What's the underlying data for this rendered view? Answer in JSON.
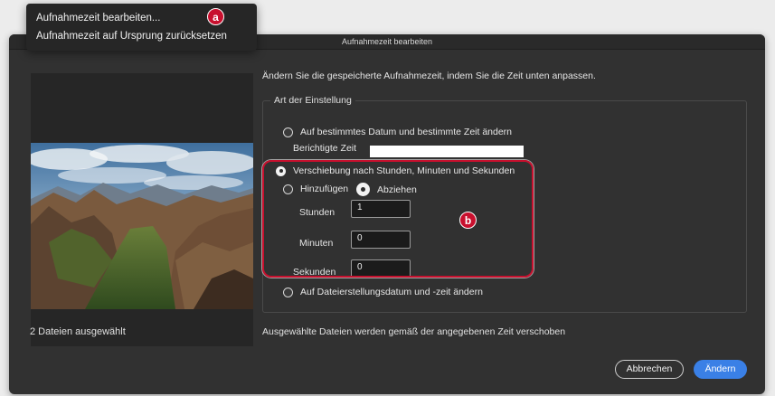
{
  "context_menu": {
    "items": [
      {
        "label": "Aufnahmezeit bearbeiten..."
      },
      {
        "label": "Aufnahmezeit auf Ursprung zurücksetzen"
      }
    ]
  },
  "annotations": {
    "a": "a",
    "b": "b",
    "highlight_color": "#c8102e"
  },
  "dialog": {
    "title": "Aufnahmezeit bearbeiten",
    "instruction": "Ändern Sie die gespeicherte Aufnahmezeit, indem Sie die Zeit unten anpassen.",
    "group_label": "Art der Einstellung",
    "options": {
      "specific": {
        "label": "Auf bestimmtes Datum und bestimmte Zeit ändern",
        "checked": false
      },
      "corrected_time_label": "Berichtigte Zeit",
      "corrected_time_value": "",
      "shift": {
        "label": "Verschiebung nach Stunden, Minuten und Sekunden",
        "checked": true
      },
      "add": {
        "label": "Hinzufügen",
        "checked": false
      },
      "subtract": {
        "label": "Abziehen",
        "checked": true
      },
      "hours_label": "Stunden",
      "hours_value": "1",
      "minutes_label": "Minuten",
      "minutes_value": "0",
      "seconds_label": "Sekunden",
      "seconds_value": "0",
      "file_created": {
        "label": "Auf Dateierstellungsdatum und -zeit ändern",
        "checked": false
      }
    },
    "files_selected": "2 Dateien ausgewählt",
    "status": "Ausgewählte Dateien werden gemäß der angegebenen Zeit verschoben",
    "buttons": {
      "cancel": "Abbrechen",
      "apply": "Ändern"
    },
    "accent_color": "#3a80e6"
  }
}
